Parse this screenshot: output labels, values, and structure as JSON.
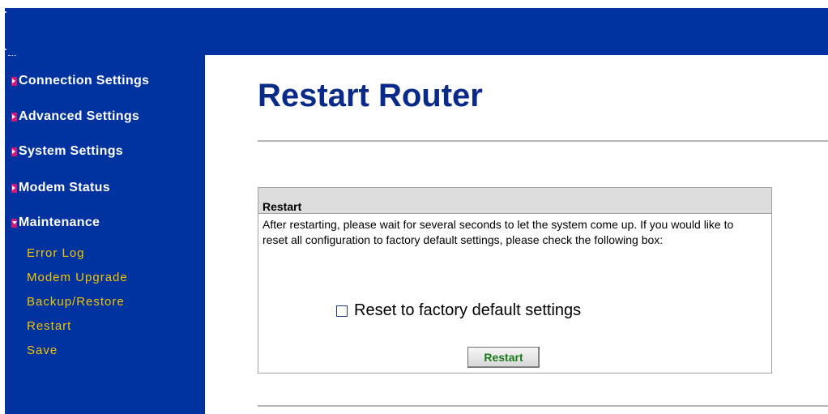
{
  "sidebar": {
    "sections": [
      {
        "label": "Connection Settings"
      },
      {
        "label": "Advanced Settings"
      },
      {
        "label": "System Settings"
      },
      {
        "label": "Modem Status"
      },
      {
        "label": "Maintenance"
      }
    ],
    "maintenance_items": [
      {
        "label": "Error Log"
      },
      {
        "label": "Modem Upgrade"
      },
      {
        "label": "Backup/Restore"
      },
      {
        "label": "Restart"
      },
      {
        "label": "Save"
      }
    ]
  },
  "main": {
    "title": "Restart Router",
    "panel": {
      "heading": "Restart",
      "description": "After restarting, please wait for several seconds to let the system come up. If you would like to reset all configuration to factory default settings, please check the following box:",
      "checkbox_label": "Reset to factory default settings",
      "checkbox_checked": false,
      "button_label": "Restart"
    }
  },
  "colors": {
    "nav_background": "#0033a0",
    "submenu_text": "#f2c500",
    "title_text": "#0a2a8a",
    "button_text": "#1a7a1a",
    "arrow_marker": "#d0187a"
  }
}
